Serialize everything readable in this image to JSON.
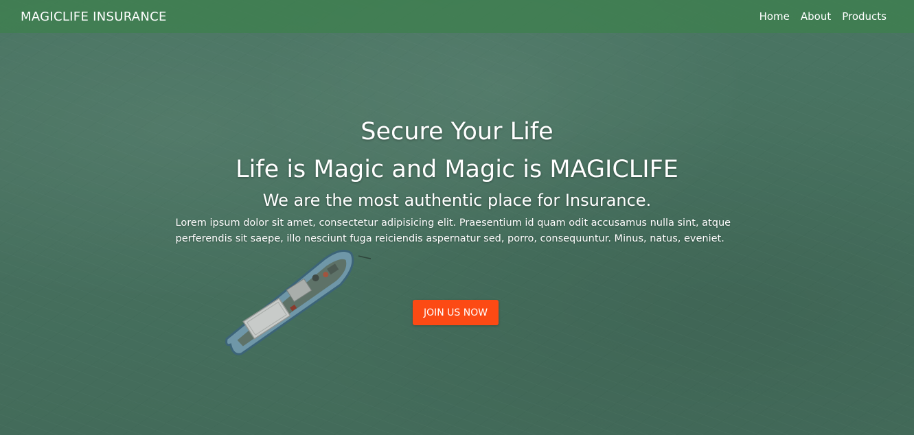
{
  "navbar": {
    "brand": "MAGICLIFE INSURANCE",
    "links": [
      "Home",
      "About",
      "Products"
    ]
  },
  "hero": {
    "line1": "Secure Your Life",
    "line2": "Life is Magic and Magic is MAGICLIFE",
    "line3": "We are the most authentic place for Insurance.",
    "paragraph": "Lorem ipsum dolor sit amet, consectetur adipisicing elit. Praesentium id quam odit accusamus nulla sint, atque perferendis sit saepe, illo nesciunt fuga reiciendis aspernatur sed, porro, consequuntur. Minus, natus, eveniet.",
    "cta_label": "JOIN US NOW"
  },
  "colors": {
    "navbar": "#3e804e",
    "cta": "#fc4a14",
    "water": "#46705e"
  }
}
